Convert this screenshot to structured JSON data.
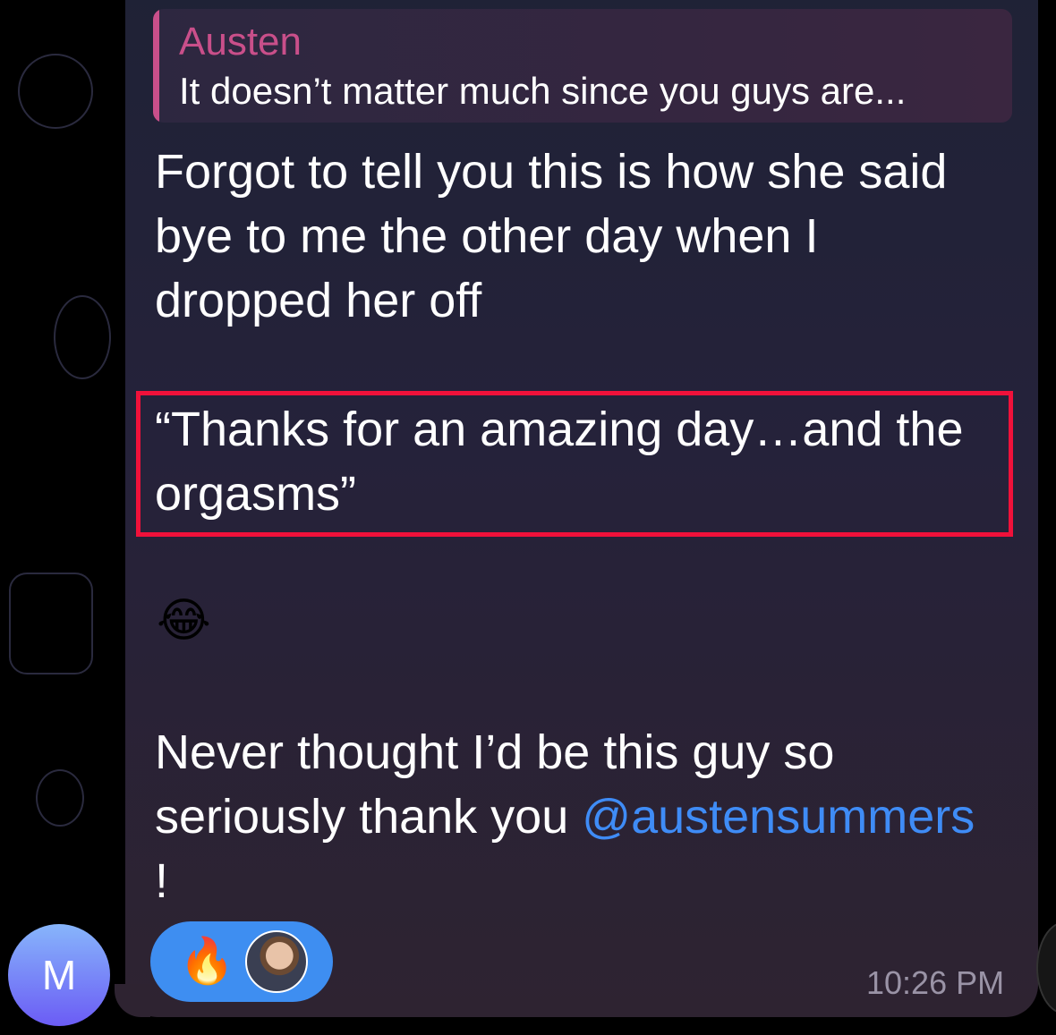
{
  "reply": {
    "author": "Austen",
    "text": "It doesn’t matter much since you guys are..."
  },
  "message": {
    "lines": [
      "Forgot to tell you this is how she said",
      "bye to me the other day when I",
      "dropped her off",
      "“Thanks for an amazing day…and the",
      "orgasms”",
      "Never thought I’d be this guy so",
      "seriously thank you ",
      "!"
    ],
    "mention": "@austensummers",
    "emoji": "😂",
    "time": "10:26 PM"
  },
  "reaction": {
    "emoji": "🔥",
    "count_avatar": "reactor-photo"
  },
  "sender_avatar": {
    "initial": "M"
  },
  "colors": {
    "highlight": "#f0113a",
    "mention": "#3f8cf6",
    "reply_accent": "#c94f8a",
    "reaction_bg": "#3e8ef1"
  }
}
